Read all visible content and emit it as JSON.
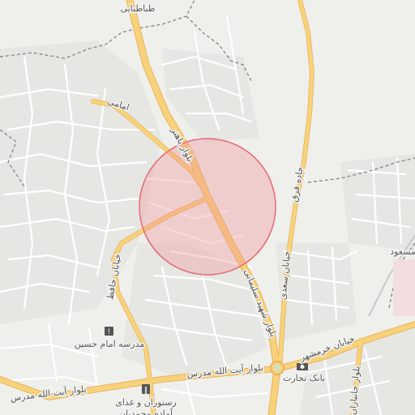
{
  "map": {
    "colors": {
      "background": "#efefec",
      "minor_road": "#ffffff",
      "major_road": "#f8d27b",
      "major_road_casing": "#e7b45a",
      "boundary": "#8a8a8a",
      "highlight_fill": "#f28f95",
      "highlight_stroke": "#e46a73"
    },
    "labels": {
      "tabatabaei": "طباطبایی",
      "imami": "امامی",
      "bolvar_bahonar": "بلوار باهنر",
      "jadeh_qaresh": "جاده قرق",
      "masoud": "مسعود",
      "khiaban_saadi": "خیابان سعدی",
      "bolvar_shahid_soleimani": "بلوار شهید سلیمانی",
      "khiaban_hafez": "خیابان حافظ",
      "khiaban_khorramshahr": "خیابان خرمشهر",
      "madreseh_imam_hossein": "مدرسه امام حسین",
      "bolvar_ayatollah_modarres_east": "بلوار آیت الله مدرس",
      "bolvar_ayatollah_modarres_west": "بلوار آیت الله مدرس",
      "bank_tejarat": "بانک تجارت",
      "resturan_va_ghaza": "رستوران و غذای",
      "amadeh_mohammadian": "آماده محمدیان",
      "bolvar_jananbaz": "بلوار جانبازان"
    },
    "icons": {
      "school": "school-icon",
      "restaurant": "restaurant-icon",
      "bank": "bank-icon",
      "roundabout": "roundabout-icon"
    }
  }
}
